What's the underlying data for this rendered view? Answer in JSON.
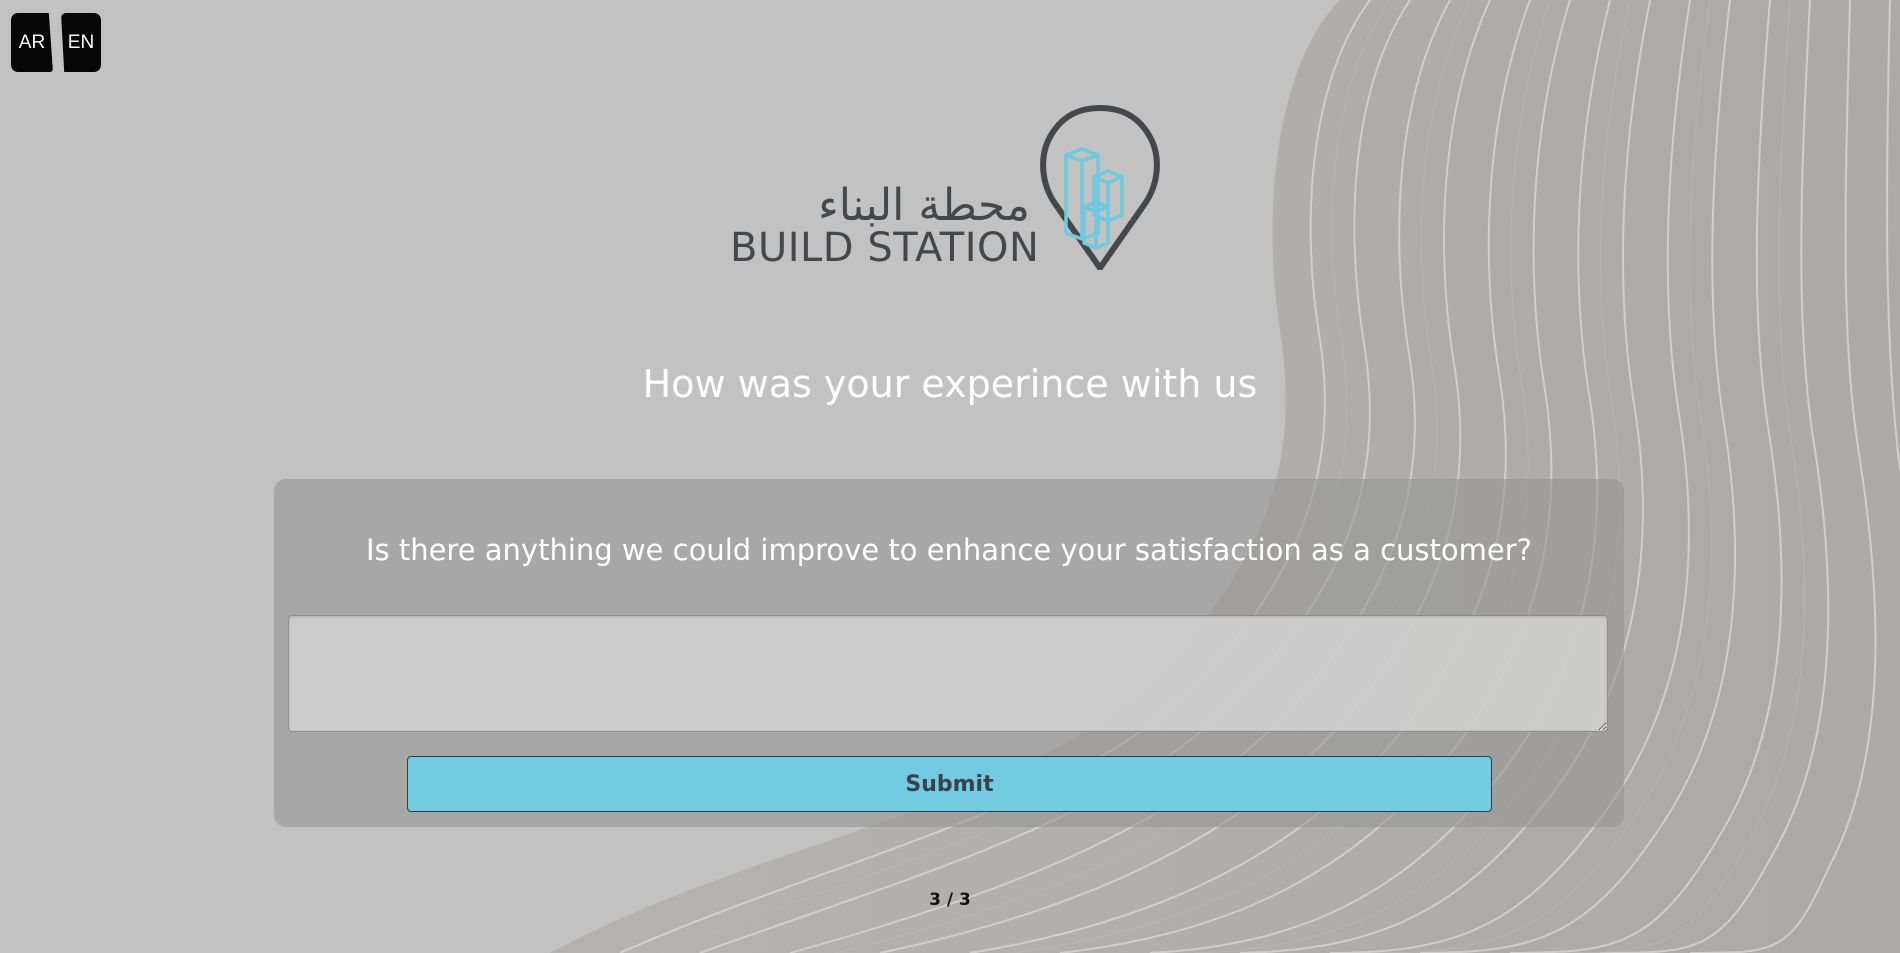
{
  "language_switch": {
    "ar_label": "AR",
    "en_label": "EN"
  },
  "logo": {
    "arabic_text": "محطة البناء",
    "english_text": "BUILD STATION",
    "colors": {
      "text": "#45484b",
      "accent": "#6fc9e0"
    }
  },
  "survey": {
    "headline": "How was your experince with us",
    "question": "Is there anything we could improve to enhance your satisfaction as a customer?",
    "answer_value": "",
    "submit_label": "Submit",
    "progress": "3 / 3"
  },
  "colors": {
    "background": "#c2c2c2",
    "card": "#979797",
    "submit_button": "#72cbe0"
  },
  "icons": [
    "location-pin-icon",
    "buildings-icon",
    "textarea-resize-grip-icon"
  ]
}
